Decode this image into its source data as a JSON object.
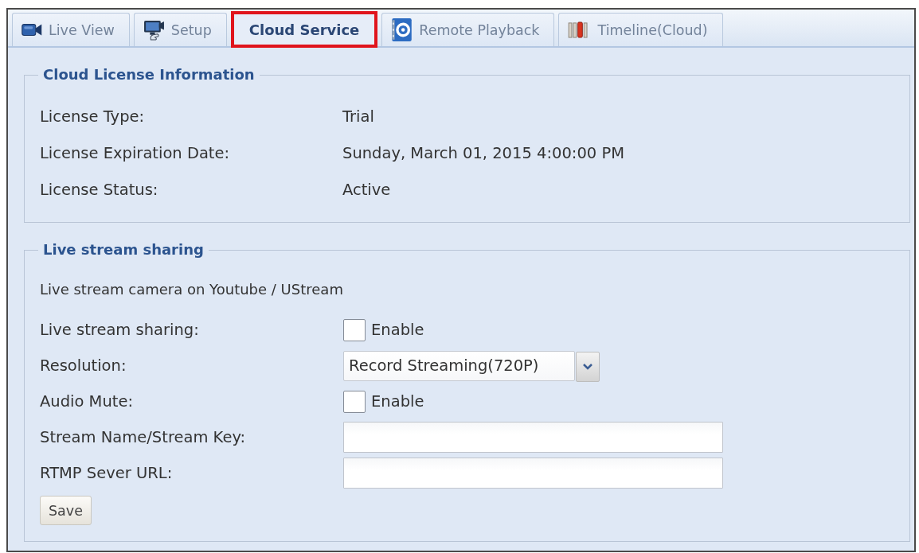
{
  "tabs": [
    {
      "label": "Live View",
      "selected": false,
      "highlighted": false
    },
    {
      "label": "Setup",
      "selected": false,
      "highlighted": false
    },
    {
      "label": "Cloud Service",
      "selected": true,
      "highlighted": true
    },
    {
      "label": "Remote Playback",
      "selected": false,
      "highlighted": false
    },
    {
      "label": "Timeline(Cloud)",
      "selected": false,
      "highlighted": false
    }
  ],
  "license_info": {
    "title": "Cloud License Information",
    "rows": [
      {
        "label": "License Type:",
        "value": "Trial"
      },
      {
        "label": "License Expiration Date:",
        "value": "Sunday, March 01, 2015 4:00:00 PM"
      },
      {
        "label": "License Status:",
        "value": "Active"
      }
    ]
  },
  "live_stream": {
    "title": "Live stream sharing",
    "description": "Live stream camera on Youtube / UStream",
    "fields": [
      {
        "kind": "checkbox",
        "label": "Live stream sharing:",
        "option": "Enable",
        "checked": false
      },
      {
        "kind": "select",
        "label": "Resolution:",
        "value": "Record Streaming(720P)"
      },
      {
        "kind": "checkbox",
        "label": "Audio Mute:",
        "option": "Enable",
        "checked": false
      },
      {
        "kind": "text",
        "label": "Stream Name/Stream Key:"
      },
      {
        "kind": "text",
        "label": "RTMP Sever URL:"
      }
    ],
    "save_button": "Save"
  }
}
